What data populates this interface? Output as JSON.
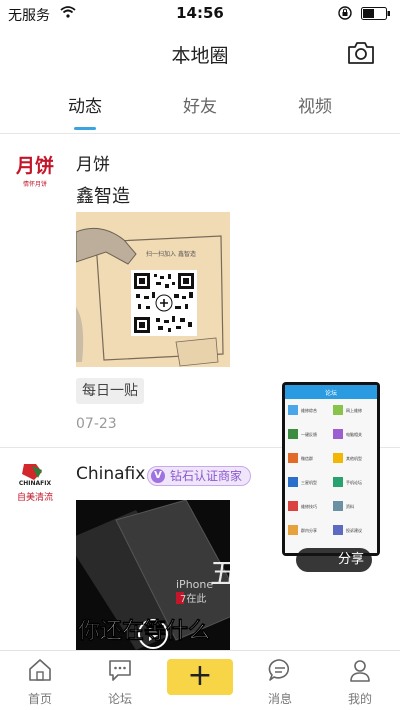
{
  "status_bar": {
    "carrier": "无服务",
    "time": "14:56"
  },
  "header": {
    "title": "本地圈"
  },
  "tabs": [
    {
      "label": "动态",
      "active": true
    },
    {
      "label": "好友",
      "active": false
    },
    {
      "label": "视频",
      "active": false
    }
  ],
  "posts": [
    {
      "avatar_text": "月饼",
      "avatar_slogan": "情怀月饼",
      "user": "月饼",
      "text": "鑫智造",
      "image_caption": "扫一扫加入 鑫智造",
      "tag": "每日一贴",
      "date": "07-23"
    },
    {
      "avatar_text": "CHINAFIX",
      "avatar_slogan": "自美清流",
      "user": "Chinafix",
      "badge_icon": "V",
      "badge": "钻石认证商家",
      "video_text_small": "iPhone",
      "video_text_small2": "7在此",
      "video_caption": "你还在等什么"
    }
  ],
  "overlay": {
    "title": "论坛",
    "items": [
      "维修综合",
      "网上维修",
      "一键反馈",
      "电脑相关",
      "微信群",
      "其他机型",
      "三星机型",
      "手机论坛",
      "维修技巧",
      "资料",
      "群内分享",
      "投诉建议"
    ]
  },
  "share_label": "分享",
  "watermark": "五女机",
  "bottom_nav": [
    {
      "label": "首页",
      "icon": "home-icon"
    },
    {
      "label": "论坛",
      "icon": "forum-icon"
    },
    {
      "label": "+",
      "icon": "plus-icon"
    },
    {
      "label": "消息",
      "icon": "message-icon"
    },
    {
      "label": "我的",
      "icon": "profile-icon"
    }
  ],
  "colors": {
    "accent": "#3aa4e0",
    "plus_button": "#f7d547",
    "badge": "#a071e0"
  }
}
